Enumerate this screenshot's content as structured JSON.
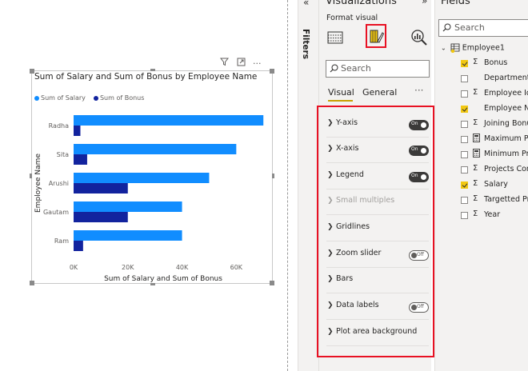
{
  "canvas": {
    "chart_title": "Sum of Salary and Sum of Bonus by Employee Name",
    "legend": [
      {
        "label": "Sum of Salary",
        "color": "#118DFF"
      },
      {
        "label": "Sum of Bonus",
        "color": "#12239E"
      }
    ],
    "header_icons": [
      "filter-icon",
      "focus-mode-icon",
      "more-options-icon"
    ]
  },
  "chart_data": {
    "type": "bar",
    "orientation": "horizontal",
    "title": "Sum of Salary and Sum of Bonus by Employee Name",
    "xlabel": "Sum of Salary and Sum of Bonus",
    "ylabel": "Employee Name",
    "categories": [
      "Radha",
      "Sita",
      "Arushi",
      "Gautam",
      "Ram"
    ],
    "series": [
      {
        "name": "Sum of Salary",
        "color": "#118DFF",
        "values": [
          70000,
          60000,
          50000,
          40000,
          40000
        ]
      },
      {
        "name": "Sum of Bonus",
        "color": "#12239E",
        "values": [
          2500,
          5000,
          20000,
          20000,
          3500
        ]
      }
    ],
    "xlim": [
      0,
      72000
    ],
    "x_ticks": [
      "0K",
      "20K",
      "40K",
      "60K"
    ],
    "x_tick_values": [
      0,
      20000,
      40000,
      60000
    ],
    "legend_position": "top-left",
    "grid": false
  },
  "filters": {
    "label": "Filters",
    "collapse_icon": "chevron-left-icon"
  },
  "visualizations": {
    "title": "Visualizations",
    "expand_icon": "chevron-right-icon",
    "format_label": "Format visual",
    "search_placeholder": "Search",
    "tabs": [
      {
        "label": "Visual"
      },
      {
        "label": "General"
      }
    ],
    "more": "···",
    "sections": [
      {
        "label": "Y-axis",
        "toggle": "On"
      },
      {
        "label": "X-axis",
        "toggle": "On"
      },
      {
        "label": "Legend",
        "toggle": "On"
      },
      {
        "label": "Small multiples",
        "toggle": null,
        "disabled": true
      },
      {
        "label": "Gridlines",
        "toggle": null
      },
      {
        "label": "Zoom slider",
        "toggle": "Off"
      },
      {
        "label": "Bars",
        "toggle": null
      },
      {
        "label": "Data labels",
        "toggle": "Off"
      },
      {
        "label": "Plot area background",
        "toggle": null
      }
    ]
  },
  "fields": {
    "title": "Fields",
    "search_placeholder": "Search",
    "table": "Employee1",
    "items": [
      {
        "label": "Bonus",
        "checked": true,
        "type": "Σ"
      },
      {
        "label": "Department",
        "checked": false,
        "type": ""
      },
      {
        "label": "Employee Id",
        "checked": false,
        "type": "Σ"
      },
      {
        "label": "Employee Na",
        "checked": true,
        "type": ""
      },
      {
        "label": "Joining Bonu",
        "checked": false,
        "type": "Σ"
      },
      {
        "label": "Maximum Pro",
        "checked": false,
        "type": "calc"
      },
      {
        "label": "Minimum Pro",
        "checked": false,
        "type": "calc"
      },
      {
        "label": "Projects Com",
        "checked": false,
        "type": "Σ"
      },
      {
        "label": "Salary",
        "checked": true,
        "type": "Σ"
      },
      {
        "label": "Targetted Pro",
        "checked": false,
        "type": "Σ"
      },
      {
        "label": "Year",
        "checked": false,
        "type": "Σ"
      }
    ]
  }
}
